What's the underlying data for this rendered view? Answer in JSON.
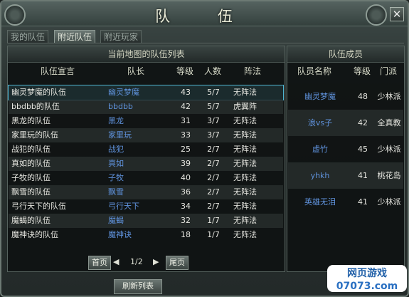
{
  "window": {
    "title": "队 伍",
    "close": "✕"
  },
  "tabs": [
    "我的队伍",
    "附近队伍",
    "附近玩家"
  ],
  "active_tab": 1,
  "left": {
    "title": "当前地图的队伍列表",
    "headers": {
      "declaration": "队伍宣言",
      "leader": "队长",
      "level": "等级",
      "count": "人数",
      "formation": "阵法"
    },
    "rows": [
      {
        "declaration": "幽灵梦魔的队伍",
        "leader": "幽灵梦魔",
        "level": "43",
        "count": "5/7",
        "formation": "无阵法"
      },
      {
        "declaration": "bbdbb的队伍",
        "leader": "bbdbb",
        "level": "42",
        "count": "5/7",
        "formation": "虎翼阵"
      },
      {
        "declaration": "黑龙的队伍",
        "leader": "黑龙",
        "level": "31",
        "count": "3/7",
        "formation": "无阵法"
      },
      {
        "declaration": "家里玩的队伍",
        "leader": "家里玩",
        "level": "33",
        "count": "3/7",
        "formation": "无阵法"
      },
      {
        "declaration": "战犯的队伍",
        "leader": "战犯",
        "level": "25",
        "count": "2/7",
        "formation": "无阵法"
      },
      {
        "declaration": "真如的队伍",
        "leader": "真如",
        "level": "39",
        "count": "2/7",
        "formation": "无阵法"
      },
      {
        "declaration": "子牧的队伍",
        "leader": "子牧",
        "level": "40",
        "count": "2/7",
        "formation": "无阵法"
      },
      {
        "declaration": "飘雪的队伍",
        "leader": "飘雪",
        "level": "36",
        "count": "2/7",
        "formation": "无阵法"
      },
      {
        "declaration": "弓行天下的队伍",
        "leader": "弓行天下",
        "level": "34",
        "count": "2/7",
        "formation": "无阵法"
      },
      {
        "declaration": "魔蝎的队伍",
        "leader": "魔蝎",
        "level": "32",
        "count": "1/7",
        "formation": "无阵法"
      },
      {
        "declaration": "魔神诀的队伍",
        "leader": "魔神诀",
        "level": "18",
        "count": "1/7",
        "formation": "无阵法"
      }
    ],
    "pagination": {
      "first": "首页",
      "prev": "◀",
      "page": "1/2",
      "next": "▶",
      "last": "尾页"
    }
  },
  "right": {
    "title": "队伍成员",
    "headers": {
      "name": "队员名称",
      "level": "等级",
      "sect": "门派"
    },
    "members": [
      {
        "name": "幽灵梦魔",
        "level": "48",
        "sect": "少林派"
      },
      {
        "name": "浪vs子",
        "level": "42",
        "sect": "全真教"
      },
      {
        "name": "虚竹",
        "level": "45",
        "sect": "少林派"
      },
      {
        "name": "yhkh",
        "level": "41",
        "sect": "桃花岛"
      },
      {
        "name": "英雄无泪",
        "level": "41",
        "sect": "少林派"
      }
    ]
  },
  "buttons": {
    "refresh": "刷新列表"
  },
  "watermark": {
    "line1": "网页游戏",
    "line2": "07073.com"
  }
}
